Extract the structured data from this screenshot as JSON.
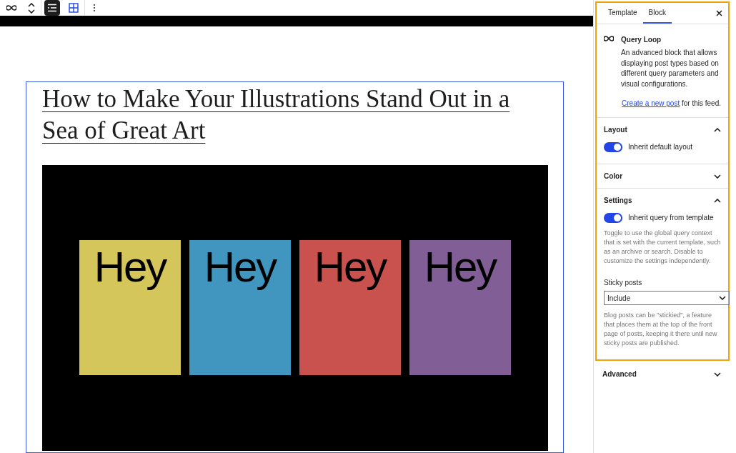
{
  "toolbar": {
    "tools": [
      {
        "kind": "list",
        "selected": true
      },
      {
        "kind": "grid",
        "selected": false
      }
    ]
  },
  "post": {
    "title": "How to Make Your Illustrations Stand Out in a Sea of Great Art",
    "cards": [
      {
        "text": "Hey",
        "color": "#d4c65a"
      },
      {
        "text": "Hey",
        "color": "#4196bf"
      },
      {
        "text": "Hey",
        "color": "#c9524f"
      },
      {
        "text": "Hey",
        "color": "#815f96"
      }
    ]
  },
  "sidebar": {
    "tabs": [
      {
        "label": "Template",
        "selected": false
      },
      {
        "label": "Block",
        "selected": true
      }
    ],
    "block": {
      "name": "Query Loop",
      "description": "An advanced block that allows displaying post types based on different query parameters and visual configurations.",
      "link": "Create a new post",
      "link_suffix": " for this feed."
    },
    "panels": [
      {
        "title": "Layout",
        "expanded": true,
        "toggle": {
          "label": "Inherit default layout",
          "on": true
        }
      },
      {
        "title": "Color",
        "expanded": false
      },
      {
        "title": "Settings",
        "expanded": true,
        "toggle": {
          "label": "Inherit query from template",
          "on": true
        },
        "help": "Toggle to use the global query context that is set with the current template, such as an archive or search. Disable to customize the settings independently.",
        "select": {
          "label": "Sticky posts",
          "value": "Include",
          "help": "Blog posts can be \"stickied\", a feature that places them at the top of the front page of posts, keeping it there until new sticky posts are published."
        }
      },
      {
        "title": "Advanced",
        "expanded": false
      }
    ]
  }
}
